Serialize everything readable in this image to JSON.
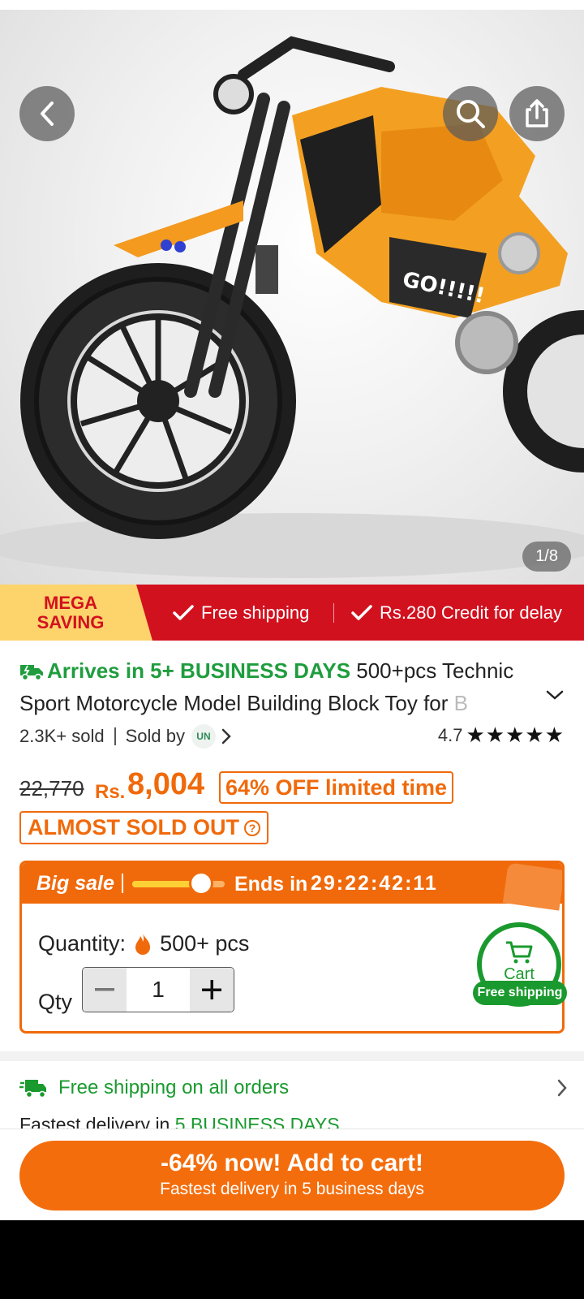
{
  "gallery": {
    "counter": "1/8",
    "icons": [
      "back-arrow-icon",
      "search-icon",
      "share-icon"
    ]
  },
  "promo": {
    "mega_line1": "MEGA",
    "mega_line2": "SAVING",
    "item1": "Free shipping",
    "item2": "Rs.280 Credit for delay"
  },
  "product": {
    "arrives": "Arrives in 5+ BUSINESS DAYS",
    "title_main": "500+pcs Technic Sport Motorcycle Model Building Block Toy for",
    "title_fade": "B",
    "sold": "2.3K+ sold",
    "sold_by": "Sold by",
    "seller_logo": "UN",
    "rating": "4.7"
  },
  "price": {
    "original": "22,770",
    "currency": "Rs.",
    "current": "8,004",
    "discount": "64% OFF limited time",
    "stock_tag": "ALMOST SOLD OUT",
    "help_mark": "?"
  },
  "sale": {
    "label": "Big sale",
    "ends_label": "Ends in",
    "timer": "29:22:42:11",
    "progress": 0.72,
    "quantity_label": "Quantity:",
    "quantity_value": "500+ pcs",
    "qty_label": "Qty",
    "qty_value": "1"
  },
  "cart_badge": {
    "label": "Cart",
    "pill": "Free shipping"
  },
  "shipping": {
    "title": "Free shipping on all orders",
    "fast_prefix": "Fastest delivery in",
    "fast_days": "5 BUSINESS DAYS"
  },
  "cta": {
    "line1": "-64% now! Add to cart!",
    "line2": "Fastest delivery in 5 business days"
  },
  "colors": {
    "accent_orange": "#f06a0b",
    "promo_red": "#d2111f",
    "green": "#1a9a2e"
  }
}
